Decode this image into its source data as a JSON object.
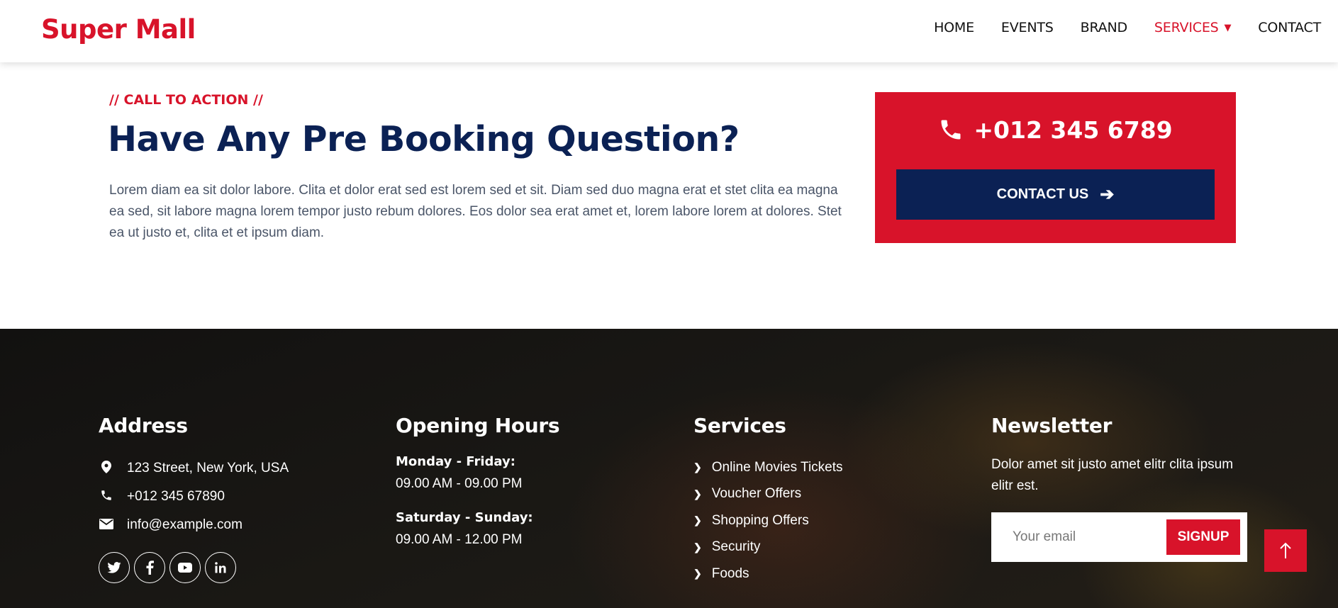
{
  "brand": {
    "name": "Super Mall",
    "color": "#D8132A"
  },
  "nav": {
    "items": [
      {
        "label": "HOME"
      },
      {
        "label": "EVENTS"
      },
      {
        "label": "BRAND"
      },
      {
        "label": "SERVICES",
        "active": true,
        "dropdown": true
      },
      {
        "label": "CONTACT"
      }
    ]
  },
  "cta": {
    "kicker": "// CALL TO ACTION //",
    "title": "Have Any Pre Booking Question?",
    "text": "Lorem diam ea sit dolor labore. Clita et dolor erat sed est lorem sed et sit. Diam sed duo magna erat et stet clita ea magna ea sed, sit labore magna lorem tempor justo rebum dolores. Eos dolor sea erat amet et, lorem labore lorem at dolores. Stet ea ut justo et, clita et et ipsum diam.",
    "phone": "+012 345 6789",
    "button_label": "CONTACT US"
  },
  "footer": {
    "address": {
      "heading": "Address",
      "street": "123 Street, New York, USA",
      "phone": "+012 345 67890",
      "email": "info@example.com",
      "social_icons": [
        "twitter-icon",
        "facebook-icon",
        "youtube-icon",
        "linkedin-icon"
      ]
    },
    "hours": {
      "heading": "Opening Hours",
      "weekday_label": "Monday - Friday:",
      "weekday_time": "09.00 AM - 09.00 PM",
      "weekend_label": "Saturday - Sunday:",
      "weekend_time": "09.00 AM - 12.00 PM"
    },
    "services": {
      "heading": "Services",
      "items": [
        "Online Movies Tickets",
        "Voucher Offers",
        "Shopping Offers",
        "Security",
        "Foods"
      ]
    },
    "newsletter": {
      "heading": "Newsletter",
      "text": "Dolor amet sit justo amet elitr clita ipsum elitr est.",
      "placeholder": "Your email",
      "button_label": "SIGNUP"
    }
  },
  "colors": {
    "primary": "#D8132A",
    "navy": "#0B2154",
    "footer_bg": "#161513"
  }
}
